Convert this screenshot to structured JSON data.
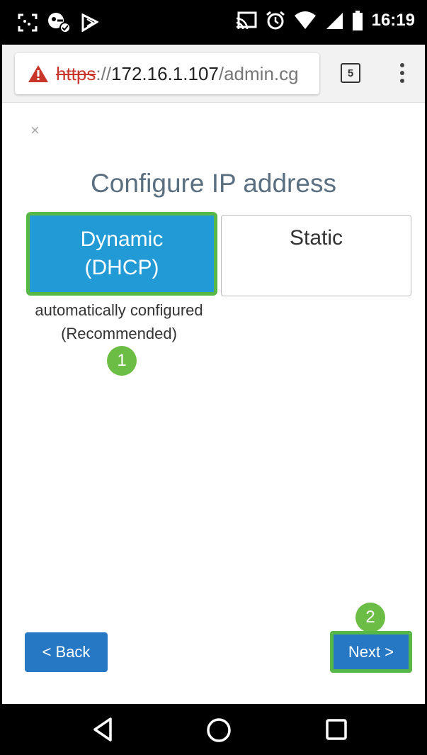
{
  "status_bar": {
    "time": "16:19",
    "icons": [
      "screenshot-icon",
      "vpn-key-icon",
      "nfc-icon",
      "cast-icon",
      "alarm-icon",
      "wifi-icon",
      "signal-icon",
      "battery-icon"
    ]
  },
  "browser": {
    "url_scheme": "https",
    "url_separator": "://",
    "url_host": "172.16.1.107",
    "url_path": "/admin.cg",
    "tab_count": "5",
    "security_icon": "warning-triangle-icon"
  },
  "dialog": {
    "close_label": "×",
    "title": "Configure IP address",
    "options": {
      "dynamic_line1": "Dynamic",
      "dynamic_line2": "(DHCP)",
      "static": "Static"
    },
    "note_line1": "automatically configured",
    "note_line2": "(Recommended)",
    "step1": "1",
    "step2": "2",
    "back_label": "< Back",
    "next_label": "Next >"
  },
  "colors": {
    "primary_blue": "#2778c4",
    "dynamic_blue": "#229ad6",
    "highlight_green": "#57b848",
    "badge_green": "#6cbd45",
    "title_gray": "#5a6f80"
  },
  "nav_bar": {
    "icons": [
      "nav-back-icon",
      "nav-home-icon",
      "nav-recents-icon"
    ]
  }
}
